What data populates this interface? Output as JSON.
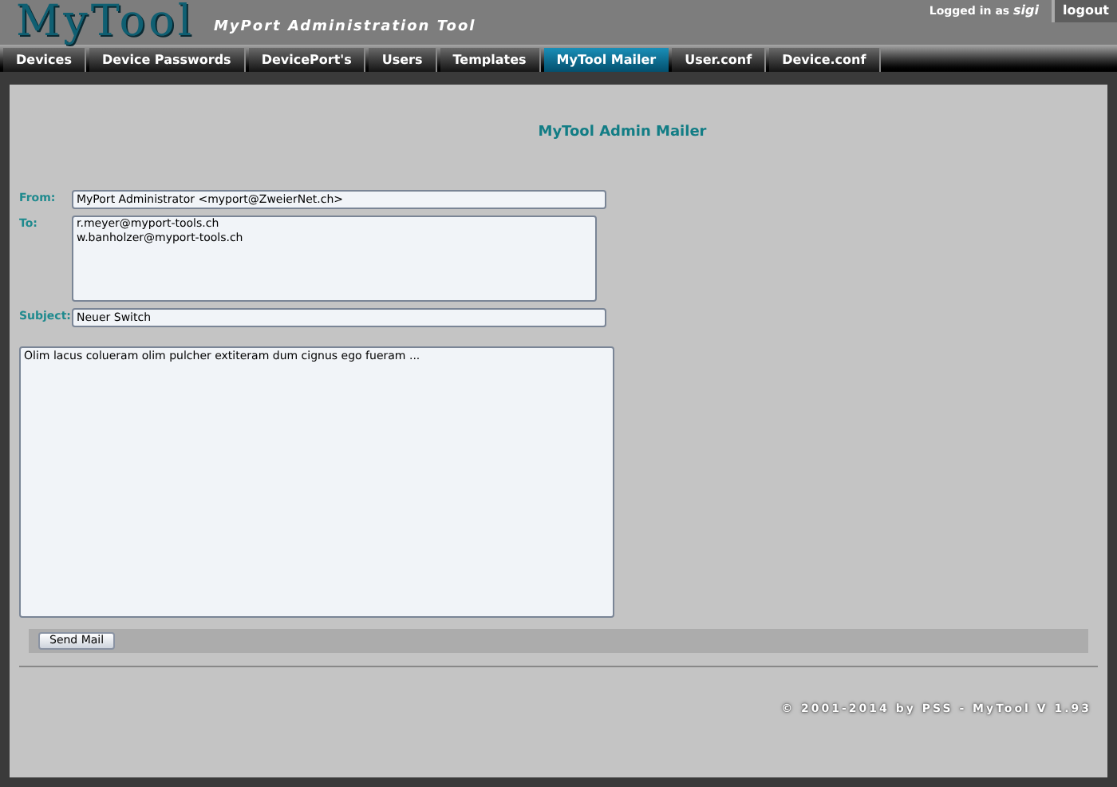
{
  "header": {
    "logo": "MyTool",
    "subtitle": "MyPort Administration Tool",
    "login_label": "Logged in as",
    "user": "sigi",
    "logout": "logout"
  },
  "tabs": [
    {
      "label": "Devices",
      "selected": false
    },
    {
      "label": "Device Passwords",
      "selected": false
    },
    {
      "label": "DevicePort's",
      "selected": false
    },
    {
      "label": "Users",
      "selected": false
    },
    {
      "label": "Templates",
      "selected": false
    },
    {
      "label": "MyTool Mailer",
      "selected": true
    },
    {
      "label": "User.conf",
      "selected": false
    },
    {
      "label": "Device.conf",
      "selected": false
    }
  ],
  "form": {
    "title": "MyTool Admin Mailer",
    "from": {
      "label": "From:",
      "value": "MyPort Administrator <myport@ZweierNet.ch>"
    },
    "to": {
      "label": "To:",
      "value": "r.meyer@myport-tools.ch\nw.banholzer@myport-tools.ch"
    },
    "subject": {
      "label": "Subject:",
      "value": "Neuer Switch"
    },
    "message": {
      "value": "Olim lacus colueram olim pulcher extiteram dum cignus ego fueram ..."
    },
    "send_button": "Send Mail"
  },
  "footer": "© 2001-2014 by PSS - MyTool V 1.93"
}
